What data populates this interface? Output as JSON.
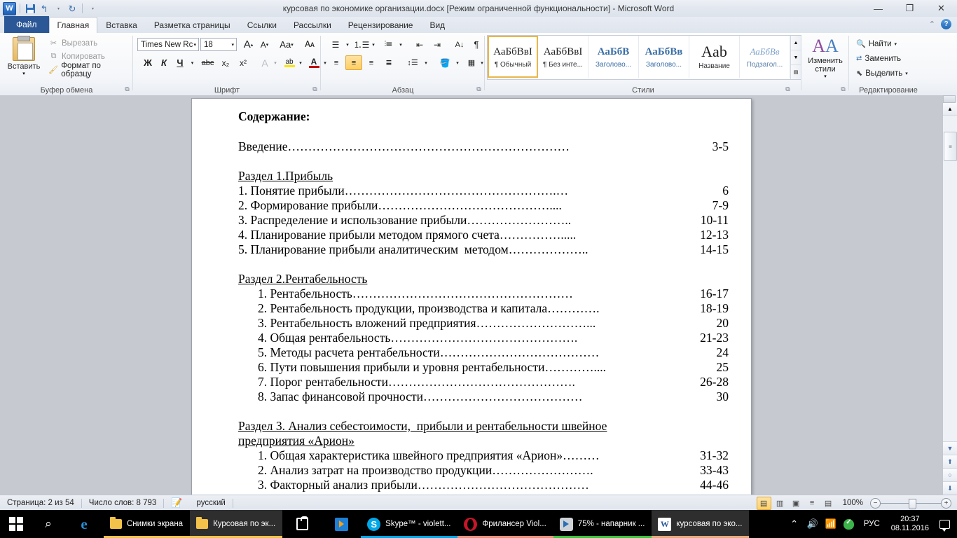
{
  "window": {
    "title": "курсовая по экономике организации.docx [Режим ограниченной функциональности]  -  Microsoft Word",
    "minimize": "—",
    "maximize": "❐",
    "close": "✕"
  },
  "qat": {
    "logo": "W",
    "save": "save-icon",
    "undo": "↰",
    "redo": "↻",
    "customize": "▾"
  },
  "ribbon": {
    "help_icon": "?",
    "collapse_icon": "⌃",
    "tabs": [
      {
        "label": "Файл",
        "type": "file"
      },
      {
        "label": "Главная",
        "type": "active"
      },
      {
        "label": "Вставка",
        "type": "normal"
      },
      {
        "label": "Разметка страницы",
        "type": "normal"
      },
      {
        "label": "Ссылки",
        "type": "normal"
      },
      {
        "label": "Рассылки",
        "type": "normal"
      },
      {
        "label": "Рецензирование",
        "type": "normal"
      },
      {
        "label": "Вид",
        "type": "normal"
      }
    ],
    "groups": {
      "clipboard": {
        "label": "Буфер обмена",
        "paste": "Вставить",
        "items": [
          {
            "label": "Вырезать",
            "icon": "scissors-icon"
          },
          {
            "label": "Копировать",
            "icon": "copy-icon"
          },
          {
            "label": "Формат по образцу",
            "icon": "format-painter-icon"
          }
        ]
      },
      "font": {
        "label": "Шрифт",
        "font_name": "Times New Rc",
        "font_size": "18",
        "grow": "A",
        "shrink": "A",
        "change_case": "Aa",
        "clear_format": "Aa",
        "bold": "Ж",
        "italic": "К",
        "underline": "Ч",
        "strikethrough": "abc",
        "subscript": "x₂",
        "superscript": "x²",
        "text_effects": "A",
        "highlight": "ab",
        "font_color": "A"
      },
      "paragraph": {
        "label": "Абзац",
        "bullets": "bullet-list-icon",
        "numbering": "numbered-list-icon",
        "multilevel": "multilevel-list-icon",
        "decrease_indent": "decrease-indent-icon",
        "increase_indent": "increase-indent-icon",
        "sort": "sort-icon",
        "show_marks": "¶",
        "align_left": "align-left-icon",
        "align_center": "align-center-icon",
        "align_right": "align-right-icon",
        "justify": "justify-icon",
        "line_spacing": "line-spacing-icon",
        "shading": "shading-icon",
        "borders": "borders-icon"
      },
      "styles": {
        "label": "Стили",
        "items": [
          {
            "preview": "АаБбВвI",
            "name": "¶ Обычный",
            "selected": true
          },
          {
            "preview": "АаБбВвI",
            "name": "¶ Без инте...",
            "selected": false
          },
          {
            "preview": "АаБбВ",
            "name": "Заголово...",
            "selected": false
          },
          {
            "preview": "АаБбВв",
            "name": "Заголово...",
            "selected": false
          },
          {
            "preview": "Aab",
            "name": "Название",
            "selected": false
          },
          {
            "preview": "АаБбВв",
            "name": "Подзагол...",
            "selected": false
          }
        ],
        "change_styles": "Изменить стили"
      },
      "editing": {
        "label": "Редактирование",
        "items": [
          {
            "label": "Найти",
            "icon": "binoculars-icon",
            "caret": "▾"
          },
          {
            "label": "Заменить",
            "icon": "replace-icon",
            "caret": ""
          },
          {
            "label": "Выделить",
            "icon": "select-icon",
            "caret": "▾"
          }
        ]
      }
    }
  },
  "document": {
    "heading": "Содержание:",
    "intro": {
      "text": "Введение",
      "dots": "……………………………………………………………",
      "page": "3-5"
    },
    "sections": [
      {
        "title": "Раздел 1.Прибыль",
        "indent": false,
        "items": [
          {
            "text": "1. Понятие прибыли",
            "dots": "…………………………………………….…",
            "page": "6"
          },
          {
            "text": "2. Формирование прибыли",
            "dots": "……………………………………....",
            "page": "7-9"
          },
          {
            "text": "3. Распределение и использование прибыли",
            "dots": "……………………..",
            "page": "10-11"
          },
          {
            "text": "4. Планирование прибыли методом прямого счета",
            "dots": "…………….....",
            "page": "12-13"
          },
          {
            "text": "5. Планирование прибыли аналитическим  методом",
            "dots": "………………..",
            "page": "14-15"
          }
        ]
      },
      {
        "title": "Раздел 2.Рентабельность",
        "indent": true,
        "items": [
          {
            "text": "1. Рентабельность",
            "dots": "………………………………………………",
            "page": "16-17"
          },
          {
            "text": "2. Рентабельность продукции, производства и капитала",
            "dots": "………….",
            "page": "18-19"
          },
          {
            "text": "3. Рентабельность вложений предприятия",
            "dots": "………………………...",
            "page": "20"
          },
          {
            "text": "4. Общая рентабельность",
            "dots": "……………………………………….",
            "page": "21-23"
          },
          {
            "text": "5. Методы расчета рентабельности",
            "dots": "…………………………………",
            "page": "24"
          },
          {
            "text": "6. Пути повышения прибыли и уровня рентабельности",
            "dots": "…………....",
            "page": "25"
          },
          {
            "text": "7. Порог рентабельности",
            "dots": "……………………………………….",
            "page": "26-28"
          },
          {
            "text": "8. Запас финансовой прочности",
            "dots": "…………………………………",
            "page": "30"
          }
        ]
      },
      {
        "title": "Раздел 3. Анализ себестоимости,  прибыли и рентабельности швейное",
        "title2": "предприятия «Арион»",
        "indent": true,
        "items": [
          {
            "text": "1. Общая характеристика швейного предприятия «Арион»",
            "dots": "………",
            "page": "31-32"
          },
          {
            "text": "2. Анализ затрат на производство продукции",
            "dots": "…………………….",
            "page": "33-43"
          },
          {
            "text": "3. Факторный анализ прибыли",
            "dots": "……………………………………",
            "page": "44-46"
          }
        ]
      }
    ]
  },
  "statusbar": {
    "page": "Страница: 2 из 54",
    "words": "Число слов: 8 793",
    "proof_icon": "proofing-icon",
    "language": "русский",
    "views": [
      {
        "name": "print-layout",
        "glyph": "▤",
        "active": true
      },
      {
        "name": "full-screen-reading",
        "glyph": "▥",
        "active": false
      },
      {
        "name": "web-layout",
        "glyph": "▣",
        "active": false
      },
      {
        "name": "outline",
        "glyph": "≡",
        "active": false
      },
      {
        "name": "draft",
        "glyph": "▤",
        "active": false
      }
    ],
    "zoom": "100%",
    "zoom_out": "−",
    "zoom_in": "+"
  },
  "scrollbar": {
    "up": "▲",
    "down": "▼",
    "browse_prev": "⬆",
    "browse_object": "○",
    "browse_next": "⬇"
  },
  "taskbar": {
    "start": "start-button",
    "search": "search-icon",
    "apps": [
      {
        "label": "",
        "icon": "edge-icon",
        "type": "pinned",
        "accent": "#2d8fd5",
        "active": false
      },
      {
        "label": "Снимки экрана",
        "icon": "folder-icon",
        "type": "task",
        "accent": "#f2c24a",
        "active": false
      },
      {
        "label": "Курсовая по эк...",
        "icon": "folder-icon",
        "type": "task",
        "accent": "#f2c24a",
        "active": true
      },
      {
        "label": "",
        "icon": "store-icon",
        "type": "pinned",
        "accent": "#ffffff",
        "active": false
      },
      {
        "label": "",
        "icon": "movies-icon",
        "type": "pinned",
        "accent": "#1d7fd6",
        "active": false
      },
      {
        "label": "Skype™ - violett...",
        "icon": "skype-icon",
        "type": "task",
        "accent": "#00a8e8",
        "active": false
      },
      {
        "label": "Фрилансер Viol...",
        "icon": "opera-icon",
        "type": "task",
        "accent": "#c8152a",
        "active": false
      },
      {
        "label": "75% - напарник ...",
        "icon": "player-icon",
        "type": "task",
        "accent": "#3cc43c",
        "active": false
      },
      {
        "label": "курсовая по эко...",
        "icon": "word-icon",
        "type": "task",
        "accent": "#e8a87c",
        "active": true
      }
    ],
    "tray": {
      "show_hidden": "⌃",
      "volume": "volume-icon",
      "network": "network-icon",
      "antivirus": "shield-icon",
      "language": "РУС",
      "time": "20:37",
      "date": "08.11.2016",
      "notifications": "notification-icon"
    }
  }
}
